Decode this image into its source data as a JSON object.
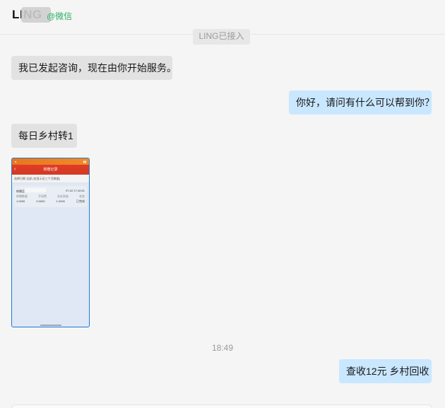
{
  "header": {
    "contact_name": "LING",
    "source_tag_icon": "at-icon",
    "source_tag": "@微信"
  },
  "system_notice": "LING已接入",
  "messages": [
    {
      "side": "left",
      "text": "我已发起咨询，现在由你开始服务。"
    },
    {
      "side": "right",
      "text": "你好，请问有什么可以帮到你？"
    },
    {
      "side": "left",
      "text": "每日乡村转1"
    },
    {
      "side": "left",
      "type": "image",
      "image": {
        "title": "转赠记录",
        "filter_label": "选择日期",
        "filter_value": "全部",
        "filter_hint": "(仅显示近三个月数据)",
        "record_name": "转赠至",
        "record_time": "07-02 17:40:51",
        "columns": [
          "转赠数量",
          "手续费",
          "实际到账",
          "状态"
        ],
        "values": [
          "1.0000",
          "0.0000",
          "1.0000",
          "已完成"
        ]
      }
    }
  ],
  "timestamp": "18:49",
  "final_message": "查收12元 乡村回收"
}
